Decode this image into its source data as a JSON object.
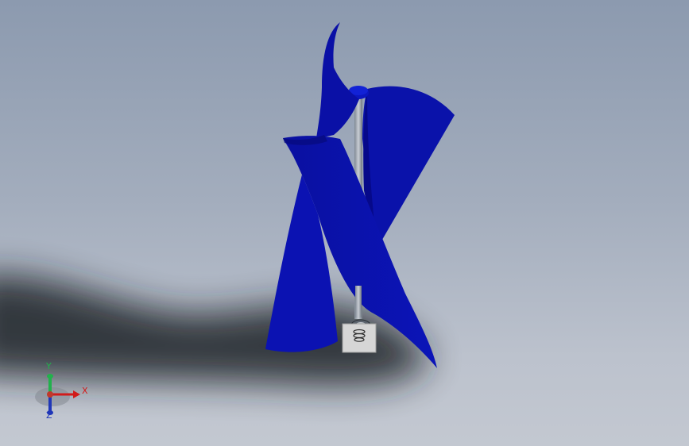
{
  "viewport": {
    "background_top": "#8c9aaf",
    "background_bottom": "#c3c8d1"
  },
  "model": {
    "name": "vertical-axis-wind-turbine",
    "blade_color": "#0a11a8",
    "blade_dark": "#050a7c",
    "shaft_color": "#9aa2ad",
    "base_color": "#d4d4d4"
  },
  "triad": {
    "x_label": "X",
    "y_label": "Y",
    "z_label": "Z",
    "x_color": "#d11b1b",
    "y_color": "#22b14c",
    "z_color": "#2037b8"
  }
}
